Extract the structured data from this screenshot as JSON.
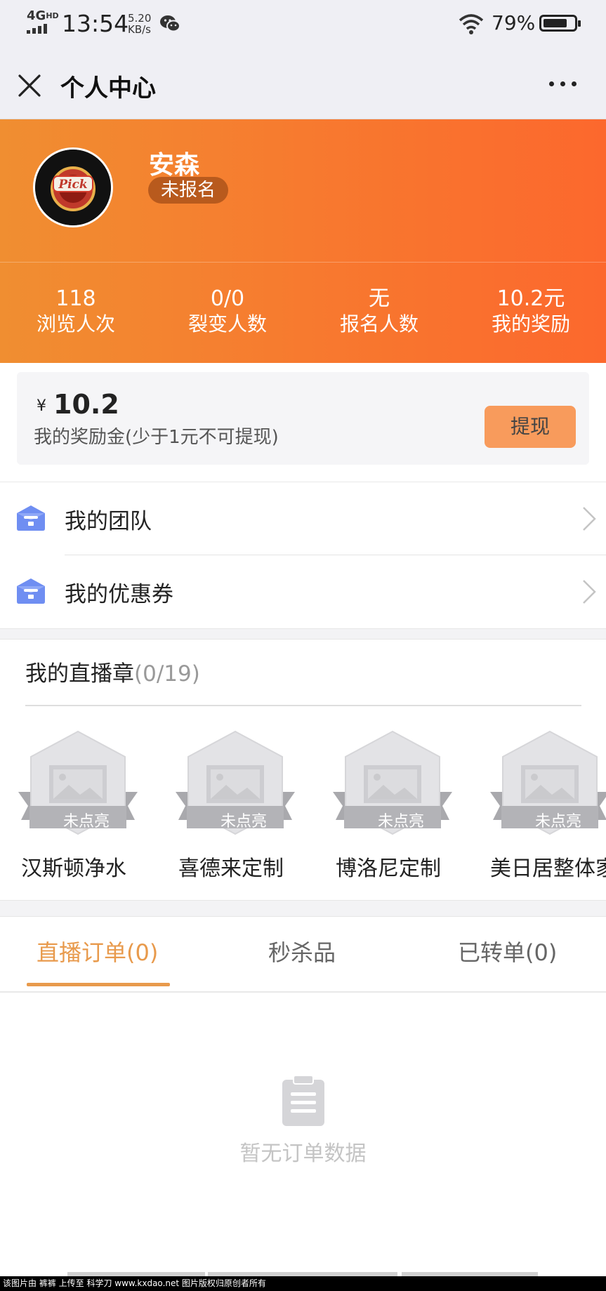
{
  "status_bar": {
    "network": "4G",
    "network_sup": "HD",
    "time": "13:54",
    "speed_value": "5.20",
    "speed_unit": "KB/s",
    "battery_text": "79%",
    "battery_level": 0.79
  },
  "nav": {
    "title": "个人中心"
  },
  "profile": {
    "name": "安森",
    "badge": "未报名",
    "avatar_text": "Pick",
    "stats": [
      {
        "value": "118",
        "label": "浏览人次"
      },
      {
        "value": "0/0",
        "label": "裂变人数"
      },
      {
        "value": "无",
        "label": "报名人数"
      },
      {
        "value": "10.2元",
        "label": "我的奖励"
      }
    ]
  },
  "reward": {
    "currency": "¥",
    "amount": "10.2",
    "description": "我的奖励金(少于1元不可提现)",
    "withdraw_label": "提现"
  },
  "menu": [
    {
      "label": "我的团队",
      "icon": "briefcase-icon"
    },
    {
      "label": "我的优惠券",
      "icon": "briefcase-icon"
    }
  ],
  "badges": {
    "title": "我的直播章",
    "count": "(0/19)",
    "items": [
      {
        "name": "汉斯顿净水",
        "status": "未点亮"
      },
      {
        "name": "喜德来定制",
        "status": "未点亮"
      },
      {
        "name": "博洛尼定制",
        "status": "未点亮"
      },
      {
        "name": "美日居整体家",
        "status": "未点亮"
      }
    ]
  },
  "tabs": [
    {
      "label": "直播订单(0)",
      "active": true
    },
    {
      "label": "秒杀品",
      "active": false
    },
    {
      "label": "已转单(0)",
      "active": false
    }
  ],
  "empty_state": {
    "text": "暂无订单数据"
  },
  "watermark": "该图片由 裤裤 上传至 科学刀 www.kxdao.net 图片版权归原创者所有",
  "colors": {
    "accent": "#e89a4c",
    "header_gradient_start": "#f08e31",
    "header_gradient_end": "#fc682d",
    "withdraw_button": "#f89b5c",
    "menu_icon": "#6f8ef2"
  }
}
